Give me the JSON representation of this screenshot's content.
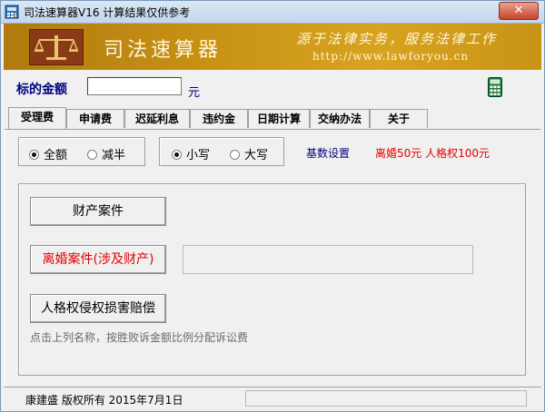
{
  "window": {
    "title": "司法速算器V16  计算结果仅供参考",
    "close_label": "✕"
  },
  "banner": {
    "brand": "司法速算器",
    "slogan": "源于法律实务，服务法律工作",
    "url": "http://www.lawforyou.cn"
  },
  "amount": {
    "label": "标的金额",
    "value": "",
    "unit": "元"
  },
  "tabs": [
    {
      "label": "受理费",
      "active": true
    },
    {
      "label": "申请费"
    },
    {
      "label": "迟延利息"
    },
    {
      "label": "违约金"
    },
    {
      "label": "日期计算"
    },
    {
      "label": "交纳办法"
    },
    {
      "label": "关于"
    }
  ],
  "options": {
    "fee_mode": [
      {
        "label": "全额",
        "checked": true
      },
      {
        "label": "减半",
        "checked": false
      }
    ],
    "case_mode": [
      {
        "label": "小写",
        "checked": true
      },
      {
        "label": "大写",
        "checked": false
      }
    ],
    "base_settings": "基数设置",
    "note": "离婚50元  人格权100元"
  },
  "buttons": {
    "property_case": "财产案件",
    "divorce_case": "离婚案件(涉及财产)",
    "personality_case": "人格权侵权损害赔偿"
  },
  "hint": "点击上列名称，按胜败诉金额比例分配诉讼费",
  "status": {
    "copyright": "康建盛  版权所有   2015年7月1日"
  },
  "colors": {
    "banner": "#c99316",
    "label_blue": "#000080",
    "accent_red": "#e00000"
  }
}
